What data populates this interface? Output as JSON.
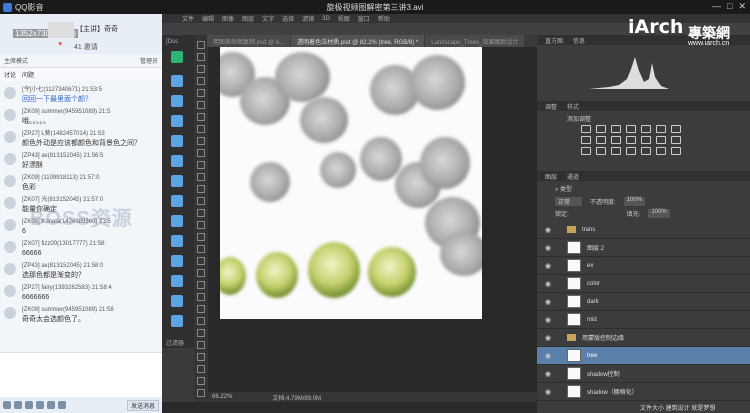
{
  "player": {
    "app_name": "QQ影音",
    "window_title": "旋极视频图解密第三讲3.avi",
    "controls": [
      "—",
      "□",
      "✕"
    ]
  },
  "qq": {
    "resolution": "1352x730(100%)",
    "host_tag": "【主讲】奇奇",
    "likes": "41",
    "invite": "邀请",
    "mode": "主席模式",
    "mode_right": "管理员",
    "tabs": [
      "讨论",
      "问题"
    ],
    "watermark": "BOSS资源",
    "messages": [
      {
        "user": "[今]小七(1127340671) 21:53:5",
        "text": "回回一下最里面个颜？",
        "blue": true
      },
      {
        "user": "[ZK09] summer(945951089) 21:5",
        "text": "哦。。。。。"
      },
      {
        "user": "[ZP27] L葵(1482457014) 21:53",
        "text": "颜色外动是应该都颜色和背景色之间？"
      },
      {
        "user": "[ZP43] ax(813152045) 21:56:5",
        "text": "好漂酥"
      },
      {
        "user": "[ZK09] (1109918113) 21:57:0",
        "text": "色彩"
      },
      {
        "user": "[ZK07] 光(813152045) 21:57:0",
        "text": "能量你确定"
      },
      {
        "user": "[ZK08] Konala(1424989360) 21:5",
        "text": "6"
      },
      {
        "user": "[ZX07] fizz00(13017777) 21:58:",
        "text": "66666"
      },
      {
        "user": "[ZP43] ax(813152045) 21:58:0",
        "text": "选那色都是渐变的？"
      },
      {
        "user": "[ZP27] fairy(1393282583) 21:58:4",
        "text": "6666666"
      },
      {
        "user": "[ZK09] summer(945951089) 21:58",
        "text": "奇奇太会选颜色了。"
      }
    ],
    "send_label": "发送消息"
  },
  "ps": {
    "menu": [
      "文件",
      "编辑",
      "图像",
      "图层",
      "文字",
      "选择",
      "滤镜",
      "3D",
      "视图",
      "窗口",
      "帮助"
    ],
    "tabs": [
      {
        "label": "用图表命图复制.psd @ 6...",
        "active": false
      },
      {
        "label": "透明着色法材质.psd @ 82.2% (tree, RGB/8) *",
        "active": true
      },
      {
        "label": "Landscape_Trees_效果图后设计",
        "active": false
      }
    ],
    "side_labels": [
      "[Doc",
      "过滤器"
    ],
    "zoom": "66.22%",
    "doc_info": "文档:4.79M/89.0M",
    "panels": {
      "top_tabs": [
        "直方图",
        "信息"
      ],
      "adjust_tabs": [
        "调整",
        "样式"
      ],
      "adjust_title": "添加调整",
      "layers_tabs": [
        "图层",
        "通道"
      ],
      "kind": "类型",
      "blend": "正常",
      "opacity_label": "不透明度:",
      "opacity": "100%",
      "lock_label": "锁定:",
      "fill_label": "填充:",
      "fill": "100%"
    },
    "layers": [
      {
        "name": "trans",
        "type": "folder",
        "selected": false
      },
      {
        "name": "图层 2",
        "type": "layer",
        "selected": false
      },
      {
        "name": "ex",
        "type": "layer",
        "selected": false
      },
      {
        "name": "color",
        "type": "layer",
        "selected": false
      },
      {
        "name": "dark",
        "type": "layer",
        "selected": false
      },
      {
        "name": "mid",
        "type": "layer",
        "selected": false
      },
      {
        "name": "用蒙版控制边缘",
        "type": "folder",
        "selected": false
      },
      {
        "name": "tree",
        "type": "layer",
        "selected": true
      },
      {
        "name": "shadow控制",
        "type": "layer",
        "selected": false
      },
      {
        "name": "shadow（棚格化）",
        "type": "layer",
        "selected": false
      }
    ]
  },
  "brand": {
    "logo": "iArch",
    "name_cn": "專築網",
    "url": "www.iarch.cn"
  },
  "corner_text": "文件大小  建筑设计 就是梦想"
}
